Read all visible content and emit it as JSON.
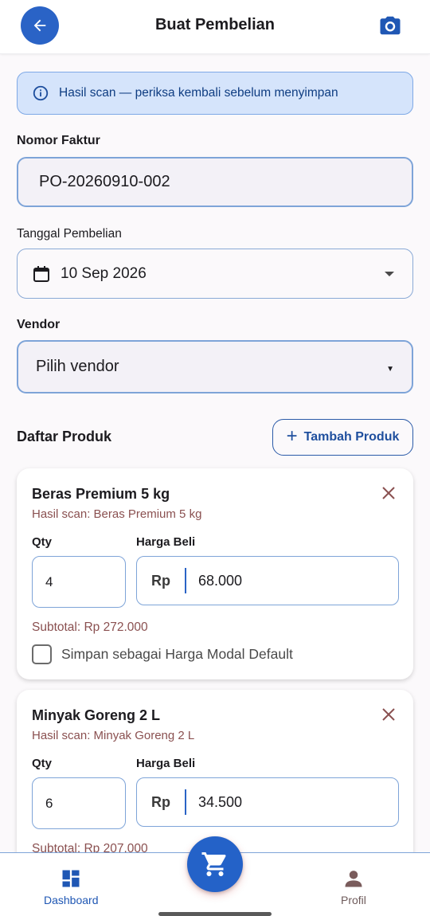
{
  "appbar": {
    "title": "Buat Pembelian",
    "back_icon": "arrow-left-icon",
    "camera_icon": "camera-icon"
  },
  "banner": {
    "icon": "info-icon",
    "text": "Hasil scan — periksa kembali sebelum menyimpan"
  },
  "form": {
    "invoice_label": "Nomor Faktur",
    "invoice_value": "PO-20260910-002",
    "date_label": "Tanggal Pembelian",
    "date_value": "10 Sep 2026",
    "vendor_label": "Vendor",
    "vendor_value": "Pilih vendor"
  },
  "products": {
    "title": "Daftar Produk",
    "add_button": "Tambah Produk",
    "qty_label": "Qty",
    "price_label": "Harga Beli",
    "currency": "Rp",
    "checkbox_label": "Simpan sebagai Harga Modal Default",
    "items": [
      {
        "name": "Beras Premium 5 kg",
        "scan": "Hasil scan: Beras Premium 5 kg",
        "qty": "4",
        "price": "68.000",
        "subtotal": "Subtotal: Rp 272.000",
        "default_price_checked": false
      },
      {
        "name": "Minyak Goreng 2 L",
        "scan": "Hasil scan: Minyak Goreng 2 L",
        "qty": "6",
        "price": "34.500",
        "subtotal": "Subtotal: Rp 207.000"
      }
    ]
  },
  "bottom_nav": {
    "dashboard": "Dashboard",
    "profile": "Profil",
    "fab_icon": "cart-icon"
  },
  "colors": {
    "primary": "#2a63c6",
    "banner_bg": "#d5e4fb",
    "accent_text": "#8a5050"
  }
}
